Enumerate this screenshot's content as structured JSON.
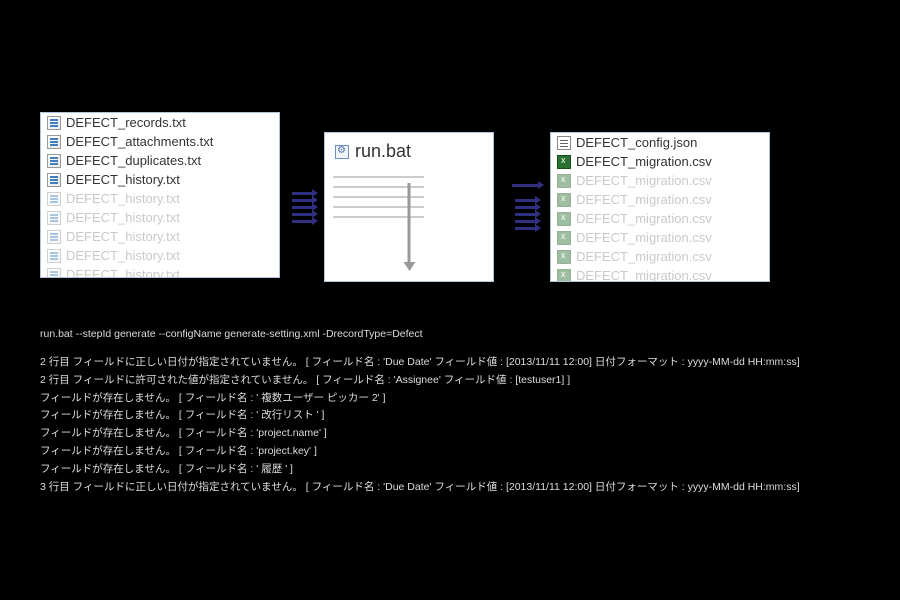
{
  "input_files": {
    "main": [
      "DEFECT_records.txt",
      "DEFECT_attachments.txt",
      "DEFECT_duplicates.txt",
      "DEFECT_history.txt"
    ],
    "faded_label": "DEFECT_history.txt",
    "faded_count": 5
  },
  "center": {
    "file": "run.bat"
  },
  "output_files": {
    "main": [
      "DEFECT_config.json",
      "DEFECT_migration.csv"
    ],
    "faded_label": "DEFECT_migration.csv",
    "faded_count": 6
  },
  "arrows_left_count": 5,
  "arrows_right_count": 5,
  "console": {
    "command": "run.bat --stepId generate --configName generate-setting.xml -DrecordType=Defect",
    "lines": [
      "2 行目 フィールドに正しい日付が指定されていません。 [ フィールド名 : 'Due Date' フィールド値 : [2013/11/11 12:00] 日付フォーマット : yyyy-MM-dd HH:mm:ss]",
      "2 行目 フィールドに許可された値が指定されていません。 [ フィールド名 : 'Assignee' フィールド値 : [testuser1] ]",
      "フィールドが存在しません。 [ フィールド名 : ' 複数ユーザー ピッカー 2' ]",
      "フィールドが存在しません。 [ フィールド名 : ' 改行リスト ' ]",
      "フィールドが存在しません。 [ フィールド名 : 'project.name' ]",
      "フィールドが存在しません。 [ フィールド名 : 'project.key' ]",
      "フィールドが存在しません。 [ フィールド名 : ' 履歴 ' ]",
      "3 行目 フィールドに正しい日付が指定されていません。 [ フィールド名 : 'Due Date' フィールド値 : [2013/11/11 12:00] 日付フォーマット : yyyy-MM-dd HH:mm:ss]"
    ]
  }
}
